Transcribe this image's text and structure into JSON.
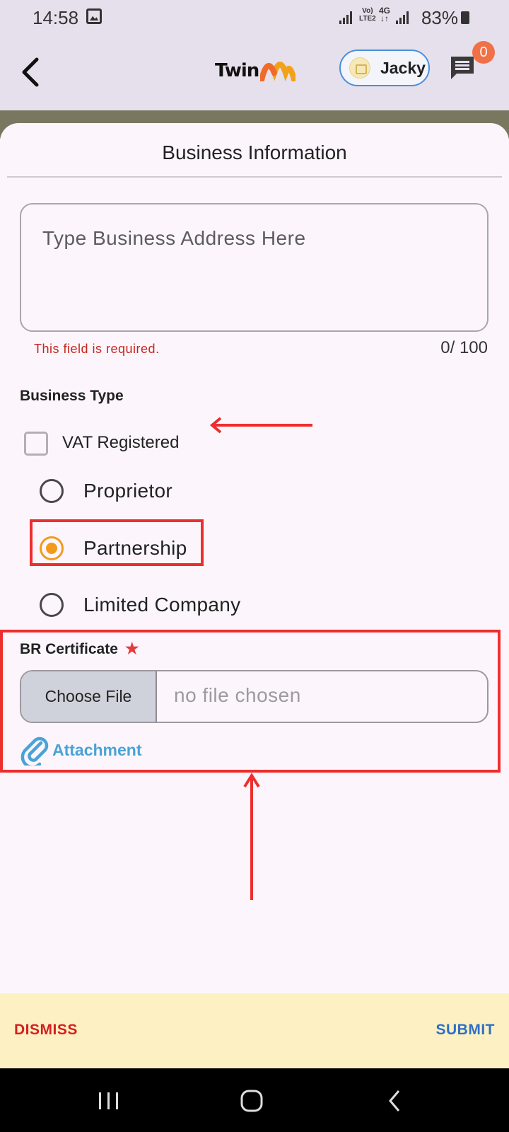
{
  "status_bar": {
    "time": "14:58",
    "network_top": "Vo)",
    "network_bottom": "LTE2",
    "data_type": "4G",
    "battery": "83%"
  },
  "app_bar": {
    "logo_text": "Twin",
    "user_name": "Jacky",
    "notification_count": "0"
  },
  "sheet": {
    "title": "Business Information",
    "address": {
      "placeholder": "Type Business Address Here",
      "value": "",
      "error": "This field is required.",
      "counter": "0/ 100"
    },
    "business_type": {
      "label": "Business Type",
      "vat_label": "VAT Registered",
      "vat_checked": false,
      "options": [
        {
          "label": "Proprietor",
          "selected": false
        },
        {
          "label": "Partnership",
          "selected": true
        },
        {
          "label": "Limited Company",
          "selected": false
        }
      ]
    },
    "br_certificate": {
      "label": "BR Certificate",
      "required_mark": "★",
      "choose_label": "Choose File",
      "file_placeholder": "no file chosen",
      "attachment_label": "Attachment"
    }
  },
  "footer": {
    "dismiss": "DISMISS",
    "submit": "SUBMIT"
  },
  "colors": {
    "accent_orange": "#f29b1a",
    "error_red": "#c4261d",
    "link_blue": "#4aa3d6",
    "submit_blue": "#2f6fc7",
    "annotation_red": "#ee2e2e"
  }
}
